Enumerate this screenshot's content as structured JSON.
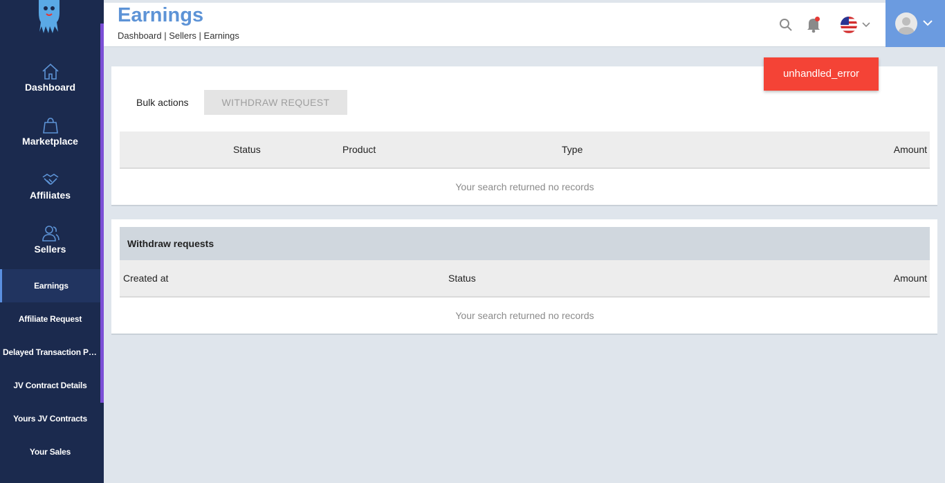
{
  "sidebar": {
    "main": [
      {
        "label": "Dashboard",
        "icon": "home-icon"
      },
      {
        "label": "Marketplace",
        "icon": "shopping-bag-icon"
      },
      {
        "label": "Affiliates",
        "icon": "handshake-icon"
      },
      {
        "label": "Sellers",
        "icon": "users-icon"
      }
    ],
    "sub": [
      {
        "label": "Earnings",
        "active": true
      },
      {
        "label": "Affiliate Request"
      },
      {
        "label": "Delayed Transaction Pay..."
      },
      {
        "label": "JV Contract Details"
      },
      {
        "label": "Yours JV Contracts"
      },
      {
        "label": "Your Sales"
      }
    ]
  },
  "header": {
    "title": "Earnings",
    "breadcrumb": "Dashboard | Sellers | Earnings"
  },
  "toast": {
    "text": "unhandled_error",
    "color": "#f44336"
  },
  "earnings": {
    "bulk_label": "Bulk actions",
    "withdraw_button": "WITHDRAW REQUEST",
    "columns": {
      "status": "Status",
      "product": "Product",
      "type": "Type",
      "amount": "Amount"
    },
    "empty": "Your search returned no records"
  },
  "withdraw": {
    "title": "Withdraw requests",
    "columns": {
      "created_at": "Created at",
      "status": "Status",
      "amount": "Amount"
    },
    "empty": "Your search returned no records"
  },
  "colors": {
    "sidebar": "#1b2a4e",
    "accent": "#5d93d6",
    "user_panel": "#6b9be0"
  }
}
